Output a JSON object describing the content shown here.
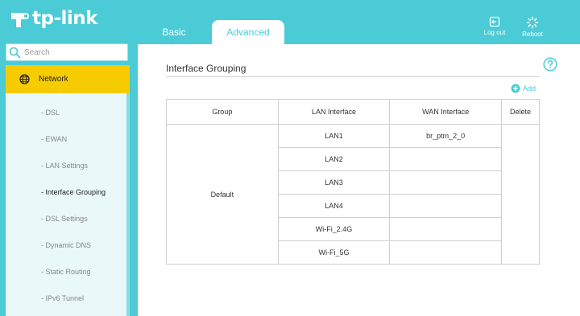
{
  "header": {
    "brand": "tp-link",
    "tabs": [
      "Basic",
      "Advanced"
    ],
    "logout_label": "Log out",
    "reboot_label": "Reboot",
    "accent_color": "#4acbd6"
  },
  "sidebar": {
    "search_placeholder": "Search",
    "section": "Network",
    "items": [
      {
        "label": "- DSL"
      },
      {
        "label": "- EWAN"
      },
      {
        "label": "- LAN Settings"
      },
      {
        "label": "- Interface Grouping"
      },
      {
        "label": "- DSL Settings"
      },
      {
        "label": "- Dynamic DNS"
      },
      {
        "label": "- Static Routing"
      },
      {
        "label": "- IPv6 Tunnel"
      }
    ],
    "section_color": "#f6cb00"
  },
  "main": {
    "title": "Interface Grouping",
    "add_label": "Add",
    "table": {
      "headers": [
        "Group",
        "LAN Interface",
        "WAN Interface",
        "Delete"
      ],
      "group": "Default",
      "lan": [
        "LAN1",
        "LAN2",
        "LAN3",
        "LAN4",
        "Wi-Fi_2.4G",
        "Wi-Fi_5G"
      ],
      "wan": [
        "br_ptm_2_0",
        "",
        "",
        "",
        "",
        ""
      ]
    }
  }
}
